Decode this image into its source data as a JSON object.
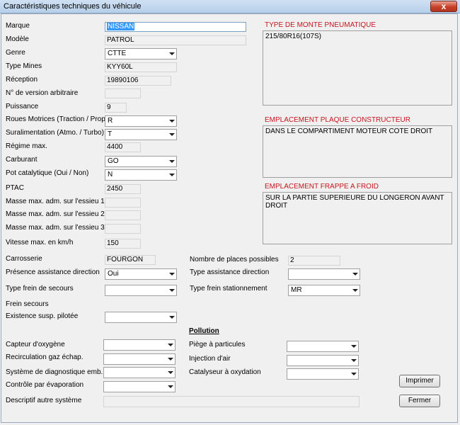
{
  "window": {
    "title": "Caractéristiques techniques du véhicule",
    "close_label": "x"
  },
  "left_fields": [
    {
      "label": "Marque",
      "value": "NISSAN"
    },
    {
      "label": "Modèle",
      "value": "PATROL"
    },
    {
      "label": "Genre",
      "value": "CTTE"
    },
    {
      "label": "Type Mines",
      "value": "KYY60L"
    },
    {
      "label": "Réception",
      "value": "19890106"
    },
    {
      "label": "N° de version arbitraire",
      "value": ""
    },
    {
      "label": "Puissance",
      "value": "9"
    },
    {
      "label": "Roues Motrices (Traction / Prop.)",
      "value": "R"
    },
    {
      "label": "Suralimentation (Atmo. / Turbo)",
      "value": "T"
    },
    {
      "label": "Régime max.",
      "value": "4400"
    },
    {
      "label": "Carburant",
      "value": "GO"
    },
    {
      "label": "Pot catalytique (Oui / Non)",
      "value": "N"
    },
    {
      "label": "PTAC",
      "value": "2450"
    },
    {
      "label": "Masse max. adm. sur l'essieu 1",
      "value": ""
    },
    {
      "label": "Masse max. adm. sur l'essieu 2",
      "value": ""
    },
    {
      "label": "Masse max. adm. sur l'essieu 3",
      "value": ""
    },
    {
      "label": "Vitesse max. en km/h",
      "value": "150"
    }
  ],
  "panels": [
    {
      "title": "TYPE DE MONTE PNEUMATIQUE",
      "value": "215/80R16(107S)"
    },
    {
      "title": "EMPLACEMENT PLAQUE CONSTRUCTEUR",
      "value": "DANS LE COMPARTIMENT MOTEUR COTE DROIT"
    },
    {
      "title": "EMPLACEMENT FRAPPE A FROID",
      "value": "SUR LA PARTIE SUPERIEURE DU LONGERON AVANT DROIT"
    }
  ],
  "carrosserie": {
    "label": "Carrosserie",
    "value": "FOURGON"
  },
  "places": {
    "label": "Nombre de places possibles",
    "value": "2"
  },
  "assistance_direction": {
    "label": "Présence assistance direction",
    "value": "Oui"
  },
  "type_assistance": {
    "label": "Type assistance direction",
    "value": ""
  },
  "frein_secours_type": {
    "label": "Type frein de secours",
    "value": ""
  },
  "frein_stationnement": {
    "label": "Type frein stationnement",
    "value": "MR"
  },
  "frein_secours": {
    "label": "Frein secours"
  },
  "susp_pilotee": {
    "label": "Existence susp. pilotée",
    "value": ""
  },
  "pollution": {
    "heading": "Pollution",
    "left": [
      {
        "label": "Capteur d'oxygène",
        "value": ""
      },
      {
        "label": "Recirculation gaz échap.",
        "value": ""
      },
      {
        "label": "Système de diagnostique emb.",
        "value": ""
      },
      {
        "label": "Contrôle par évaporation",
        "value": ""
      }
    ],
    "right": [
      {
        "label": "Piège à particules",
        "value": ""
      },
      {
        "label": "Injection d'air",
        "value": ""
      },
      {
        "label": "Catalyseur à oxydation",
        "value": ""
      }
    ]
  },
  "descriptif": {
    "label": "Descriptif autre système",
    "value": ""
  },
  "buttons": {
    "print": "Imprimer",
    "close": "Fermer"
  }
}
